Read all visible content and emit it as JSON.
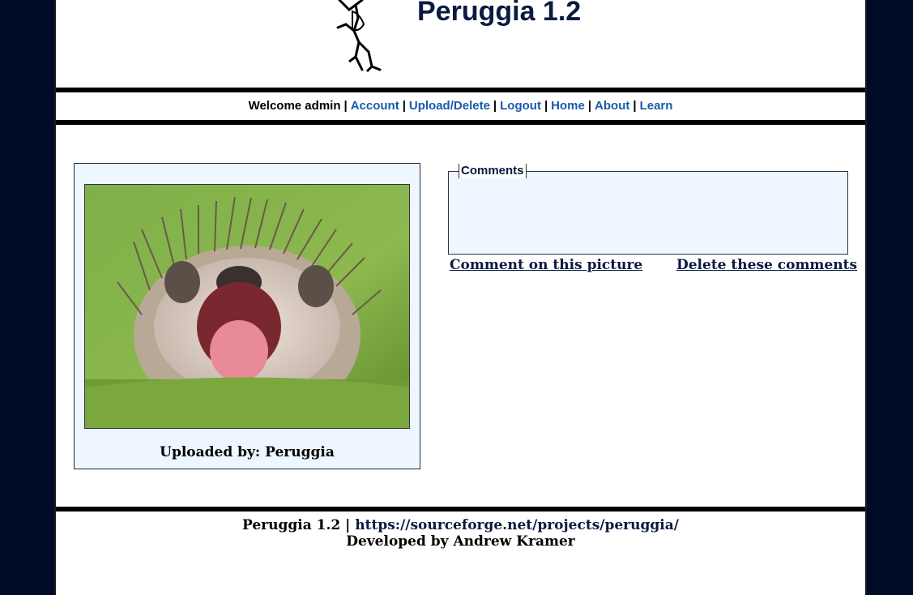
{
  "site": {
    "title": "Peruggia 1.2"
  },
  "nav": {
    "welcome": "Welcome admin",
    "separator": "|",
    "links": [
      "Account",
      "Upload/Delete",
      "Logout",
      "Home",
      "About",
      "Learn"
    ],
    "link_color": "#1a5aa8"
  },
  "photo": {
    "uploaded_by": "Uploaded by: Peruggia",
    "icon": "hedgehog-photo"
  },
  "comments": {
    "legend": "Comments",
    "comment_link": "Comment on this picture",
    "delete_link": "Delete these comments"
  },
  "footer": {
    "version": "Peruggia 1.2",
    "separator": "|",
    "url": "https://sourceforge.net/projects/peruggia/",
    "developer": "Developed by Andrew Kramer"
  },
  "colors": {
    "background": "#000c26",
    "panel": "#eef6ff",
    "title": "#0a1a40"
  }
}
